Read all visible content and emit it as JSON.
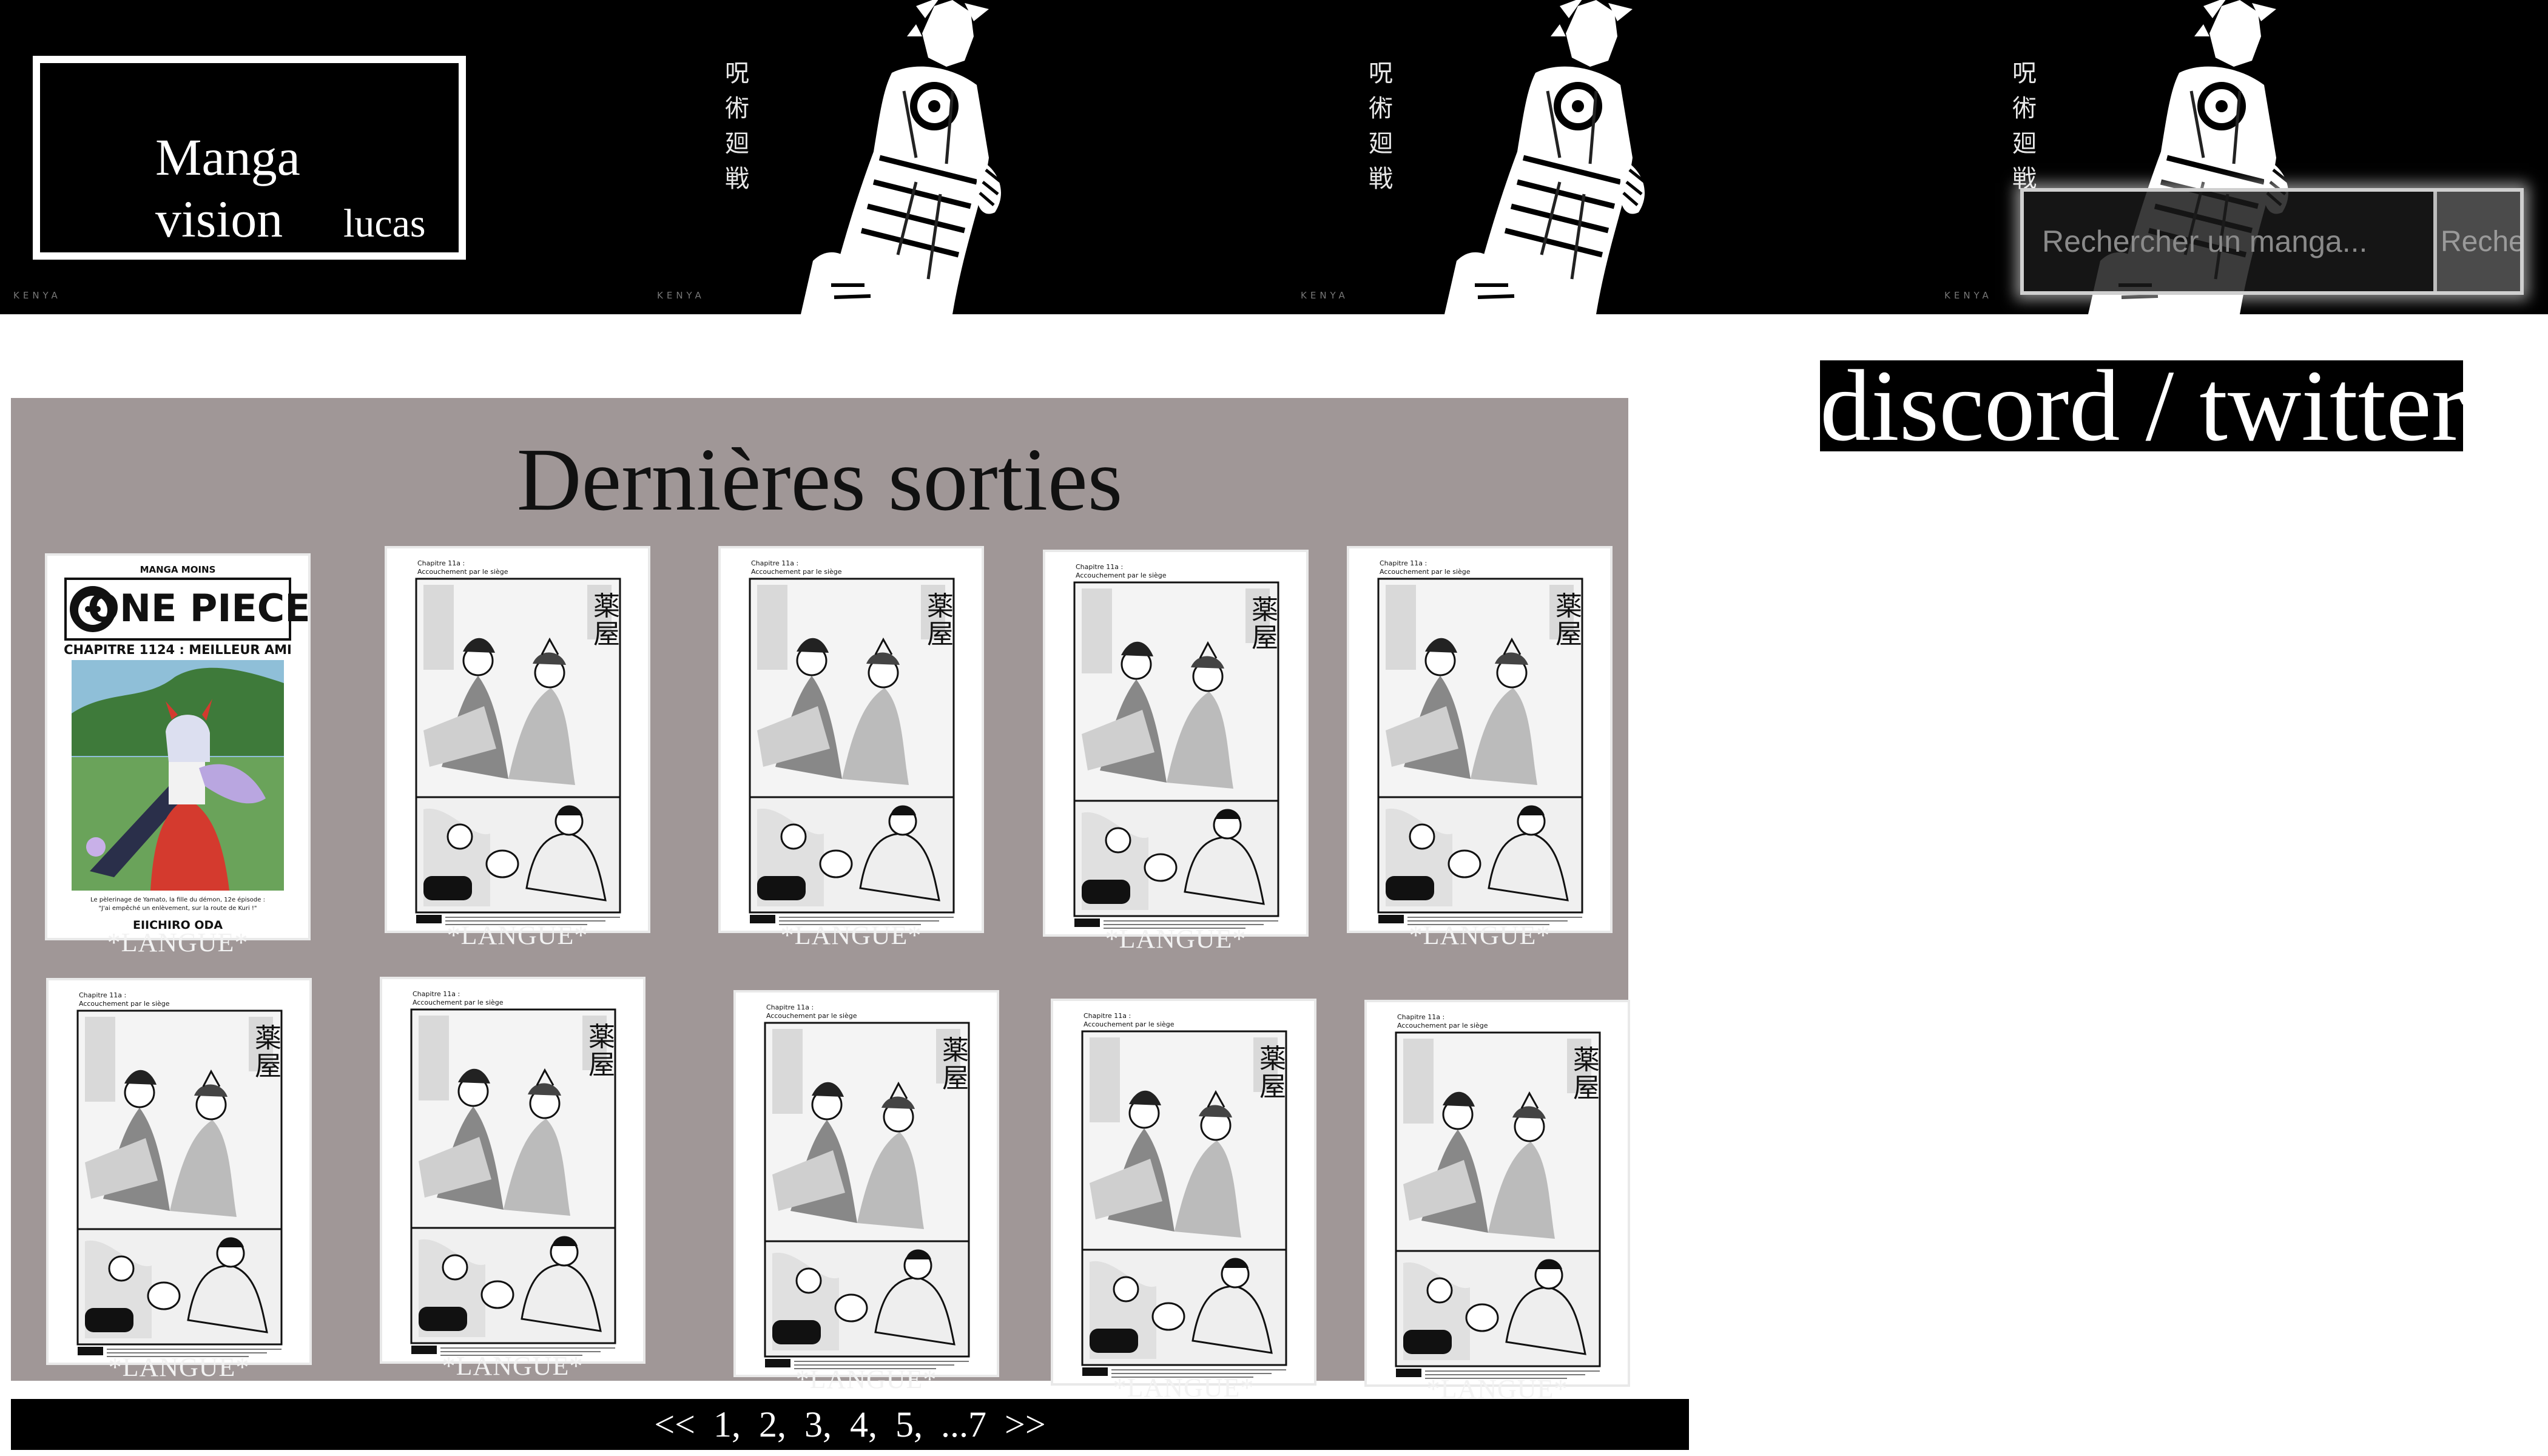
{
  "header": {
    "banner_kanji": "呪 術 廻 戦",
    "banner_mark": "KENYA",
    "logo_line1": "Manga",
    "logo_line2": "vision",
    "logo_user": "lucas",
    "search": {
      "placeholder": "Rechercher un manga...",
      "button_label": "Rechercher"
    }
  },
  "social": {
    "label": "discord / twitter"
  },
  "main": {
    "title": "Dernières sorties",
    "cards": [
      {
        "cover": "one-piece",
        "series_tag": "MANGA MOINS",
        "logo_text": "ONE PIECE",
        "chapter": "CHAPITRE 1124 : MEILLEUR AMI",
        "caption": "Le pèlerinage de Yamato, la fille du démon, 12e épisode : \"J'ai empêché un enlèvement, sur la route de Kuri !\"",
        "author": "EIICHIRO ODA",
        "language": "*LANGUE*"
      },
      {
        "cover": "kusuriya",
        "header_line1": "Chapitre 11a :",
        "header_line2": "Accouchement par le siège",
        "language": "*LANGUE*"
      },
      {
        "cover": "kusuriya",
        "header_line1": "Chapitre 11a :",
        "header_line2": "Accouchement par le siège",
        "language": "*LANGUE*"
      },
      {
        "cover": "kusuriya",
        "header_line1": "Chapitre 11a :",
        "header_line2": "Accouchement par le siège",
        "language": "*LANGUE*"
      },
      {
        "cover": "kusuriya",
        "header_line1": "Chapitre 11a :",
        "header_line2": "Accouchement par le siège",
        "language": "*LANGUE*"
      },
      {
        "cover": "kusuriya",
        "header_line1": "Chapitre 11a :",
        "header_line2": "Accouchement par le siège",
        "language": "*LANGUE*"
      },
      {
        "cover": "kusuriya",
        "header_line1": "Chapitre 11a :",
        "header_line2": "Accouchement par le siège",
        "language": "*LANGUE*"
      },
      {
        "cover": "kusuriya",
        "header_line1": "Chapitre 11a :",
        "header_line2": "Accouchement par le siège",
        "language": "*LANGUE*"
      },
      {
        "cover": "kusuriya",
        "header_line1": "Chapitre 11a :",
        "header_line2": "Accouchement par le siège",
        "language": "*LANGUE*"
      },
      {
        "cover": "kusuriya",
        "header_line1": "Chapitre 11a :",
        "header_line2": "Accouchement par le siège",
        "language": "*LANGUE*"
      }
    ]
  },
  "pagination": {
    "prev": "<<",
    "pages": [
      "1,",
      "2,",
      "3,",
      "4,",
      "5,",
      "...7"
    ],
    "next": ">>"
  }
}
